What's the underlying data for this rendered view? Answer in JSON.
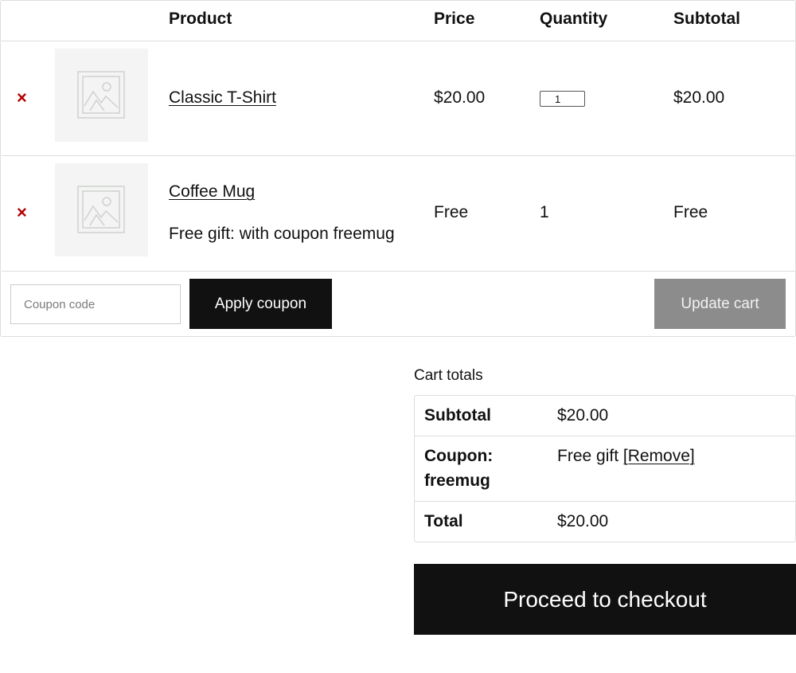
{
  "cart": {
    "headers": {
      "product": "Product",
      "price": "Price",
      "quantity": "Quantity",
      "subtotal": "Subtotal"
    },
    "remove_glyph": "×",
    "items": [
      {
        "name": "Classic T-Shirt",
        "price": "$20.00",
        "quantity": "1",
        "subtotal": "$20.00",
        "image_icon": "placeholder-image-icon"
      },
      {
        "name": "Coffee Mug",
        "note": "Free gift: with coupon freemug",
        "price": "Free",
        "quantity": "1",
        "subtotal": "Free",
        "image_icon": "placeholder-image-icon"
      }
    ],
    "coupon_placeholder": "Coupon code",
    "apply_coupon_label": "Apply coupon",
    "update_cart_label": "Update cart"
  },
  "totals": {
    "title": "Cart totals",
    "subtotal_label": "Subtotal",
    "subtotal_value": "$20.00",
    "coupon_label_line1": "Coupon:",
    "coupon_label_line2": "freemug",
    "coupon_value": "Free gift",
    "coupon_remove_label": "[Remove]",
    "total_label": "Total",
    "total_value": "$20.00"
  },
  "checkout_label": "Proceed to checkout",
  "colors": {
    "remove": "#b40000",
    "dark_button": "#111111",
    "disabled_button": "#8c8c8c",
    "border": "#dddddd",
    "thumb_bg": "#f3f4f3"
  }
}
